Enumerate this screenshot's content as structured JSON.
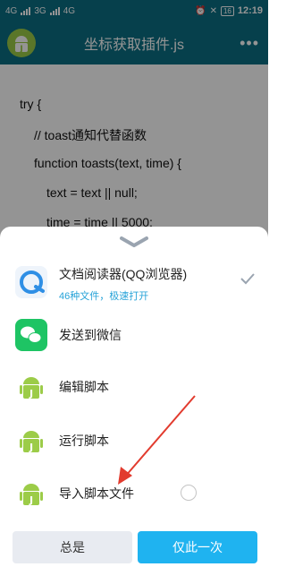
{
  "status_bar": {
    "left": [
      "4G",
      "3G",
      "4G"
    ],
    "battery": "16",
    "time": "12:19"
  },
  "app_bar": {
    "title": "坐标获取插件.js",
    "menu": "•••"
  },
  "code_lines": [
    "try {",
    "// toast通知代替函数",
    "function toasts(text, time) {",
    "text = text || null;",
    "time = time || 5000;"
  ],
  "sheet": {
    "options": [
      {
        "label": "文档阅读器(QQ浏览器)",
        "sub": "46种文件，极速打开"
      },
      {
        "label": "发送到微信"
      },
      {
        "label": "编辑脚本"
      },
      {
        "label": "运行脚本"
      },
      {
        "label": "导入脚本文件"
      }
    ],
    "always_button": "总是",
    "once_button": "仅此一次"
  },
  "colors": {
    "accent": "#1fb3f0",
    "appbar": "#0b6f83",
    "annotation_arrow": "#e23b2e"
  }
}
